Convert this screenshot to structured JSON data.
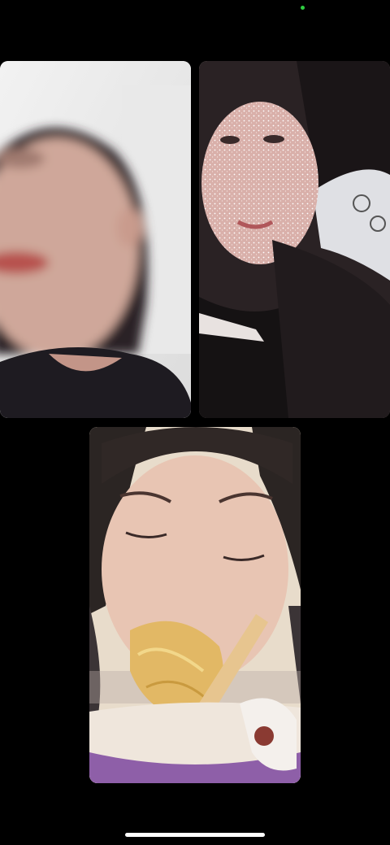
{
  "status_bar": {
    "indicator_color": "#2ecc40"
  },
  "video_call": {
    "participants": [
      {
        "tile": "participant-video-1",
        "background": "#e8e8e8"
      },
      {
        "tile": "participant-video-2",
        "background": "#c9bcb6"
      },
      {
        "tile": "participant-video-3",
        "background": "#e2d4c2"
      }
    ]
  },
  "home_indicator": {
    "color": "#ffffff"
  }
}
